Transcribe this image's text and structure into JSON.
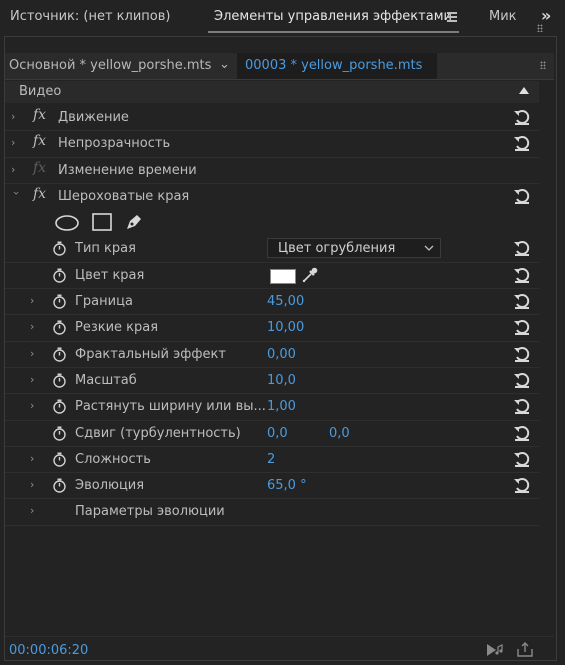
{
  "tabs": [
    {
      "label": "Источник: (нет клипов)"
    },
    {
      "label": "Элементы управления эффектами"
    },
    {
      "label": "Мик"
    }
  ],
  "source_bar": {
    "master": "Основной * yellow_porshe.mts",
    "clip": "00003 * yellow_porshe.mts"
  },
  "section": {
    "label": "Видео"
  },
  "effects": [
    {
      "label": "Движение"
    },
    {
      "label": "Непрозрачность"
    },
    {
      "label": "Изменение времени"
    },
    {
      "label": "Шероховатые края"
    }
  ],
  "params": {
    "edge_type": {
      "label": "Тип края",
      "value": "Цвет огрубления"
    },
    "edge_color": {
      "label": "Цвет края",
      "color": "#ffffff"
    },
    "border": {
      "label": "Граница",
      "value": "45,00"
    },
    "edge_sharpness": {
      "label": "Резкие края",
      "value": "10,00"
    },
    "fractal": {
      "label": "Фрактальный эффект",
      "value": "0,00"
    },
    "scale": {
      "label": "Масштаб",
      "value": "10,0"
    },
    "stretch": {
      "label": "Растянуть ширину или вы...",
      "value": "1,00"
    },
    "offset": {
      "label": "Сдвиг (турбулентность)",
      "value_x": "0,0",
      "value_y": "0,0"
    },
    "complexity": {
      "label": "Сложность",
      "value": "2"
    },
    "evolution": {
      "label": "Эволюция",
      "value": "65,0 °"
    },
    "evolution_options": {
      "label": "Параметры эволюции"
    }
  },
  "footer": {
    "timecode": "00:00:06:20"
  },
  "colors": {
    "accent": "#4b9be0",
    "background": "#232323",
    "text": "#bdbdbd"
  }
}
